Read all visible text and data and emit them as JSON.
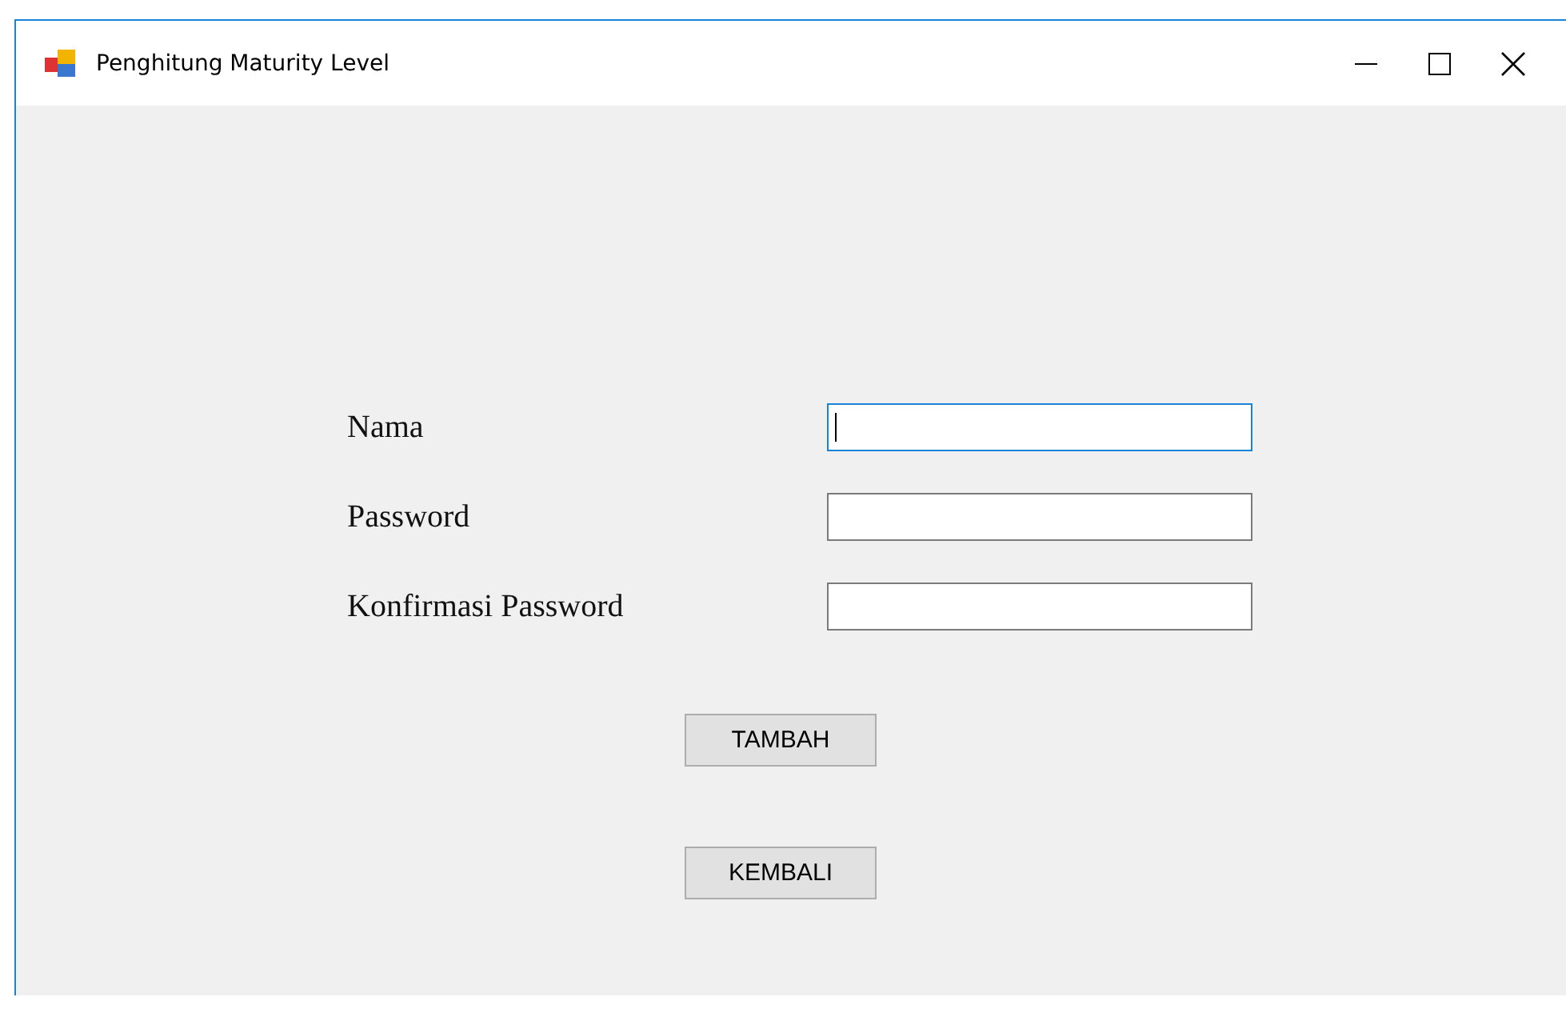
{
  "window": {
    "title": "Penghitung Maturity Level"
  },
  "fields": [
    {
      "label": "Nama",
      "focused": true
    },
    {
      "label": "Password",
      "focused": false
    },
    {
      "label": "Konfirmasi Password",
      "focused": false
    }
  ],
  "buttons": [
    "TAMBAH",
    "KEMBALI"
  ]
}
